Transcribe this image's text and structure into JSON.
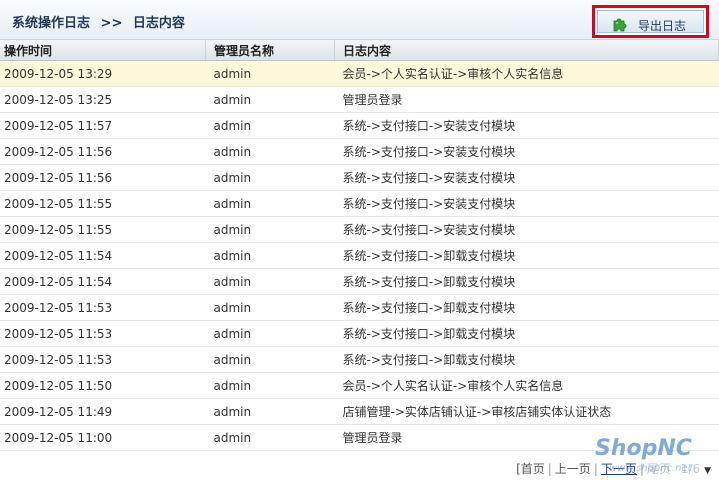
{
  "header": {
    "breadcrumb_parent": "系统操作日志",
    "breadcrumb_sep": ">>",
    "breadcrumb_current": "日志内容",
    "export_button_label": "导出日志"
  },
  "table": {
    "columns": [
      "操作时间",
      "管理员名称",
      "日志内容"
    ],
    "rows": [
      {
        "time": "2009-12-05 13:29",
        "admin": "admin",
        "content": "会员->个人实名认证->审核个人实名信息"
      },
      {
        "time": "2009-12-05 13:25",
        "admin": "admin",
        "content": "管理员登录"
      },
      {
        "time": "2009-12-05 11:57",
        "admin": "admin",
        "content": "系统->支付接口->安装支付模块"
      },
      {
        "time": "2009-12-05 11:56",
        "admin": "admin",
        "content": "系统->支付接口->安装支付模块"
      },
      {
        "time": "2009-12-05 11:56",
        "admin": "admin",
        "content": "系统->支付接口->安装支付模块"
      },
      {
        "time": "2009-12-05 11:55",
        "admin": "admin",
        "content": "系统->支付接口->安装支付模块"
      },
      {
        "time": "2009-12-05 11:55",
        "admin": "admin",
        "content": "系统->支付接口->安装支付模块"
      },
      {
        "time": "2009-12-05 11:54",
        "admin": "admin",
        "content": "系统->支付接口->卸载支付模块"
      },
      {
        "time": "2009-12-05 11:54",
        "admin": "admin",
        "content": "系统->支付接口->卸载支付模块"
      },
      {
        "time": "2009-12-05 11:53",
        "admin": "admin",
        "content": "系统->支付接口->卸载支付模块"
      },
      {
        "time": "2009-12-05 11:53",
        "admin": "admin",
        "content": "系统->支付接口->卸载支付模块"
      },
      {
        "time": "2009-12-05 11:53",
        "admin": "admin",
        "content": "系统->支付接口->卸载支付模块"
      },
      {
        "time": "2009-12-05 11:50",
        "admin": "admin",
        "content": "会员->个人实名认证->审核个人实名信息"
      },
      {
        "time": "2009-12-05 11:49",
        "admin": "admin",
        "content": "店铺管理->实体店铺认证->审核店铺实体认证状态"
      },
      {
        "time": "2009-12-05 11:00",
        "admin": "admin",
        "content": "管理员登录"
      }
    ]
  },
  "pager": {
    "first": "[首页",
    "prev": "上一页",
    "next": "下一页",
    "last": "尾页",
    "page_status": "1/6"
  },
  "watermark": {
    "brand": "ShopNC",
    "url": "www.shopnc.net"
  },
  "colors": {
    "highlight_row": "#fdf8d9",
    "export_outline": "#e0001a",
    "link_active": "#1a3c8c"
  }
}
